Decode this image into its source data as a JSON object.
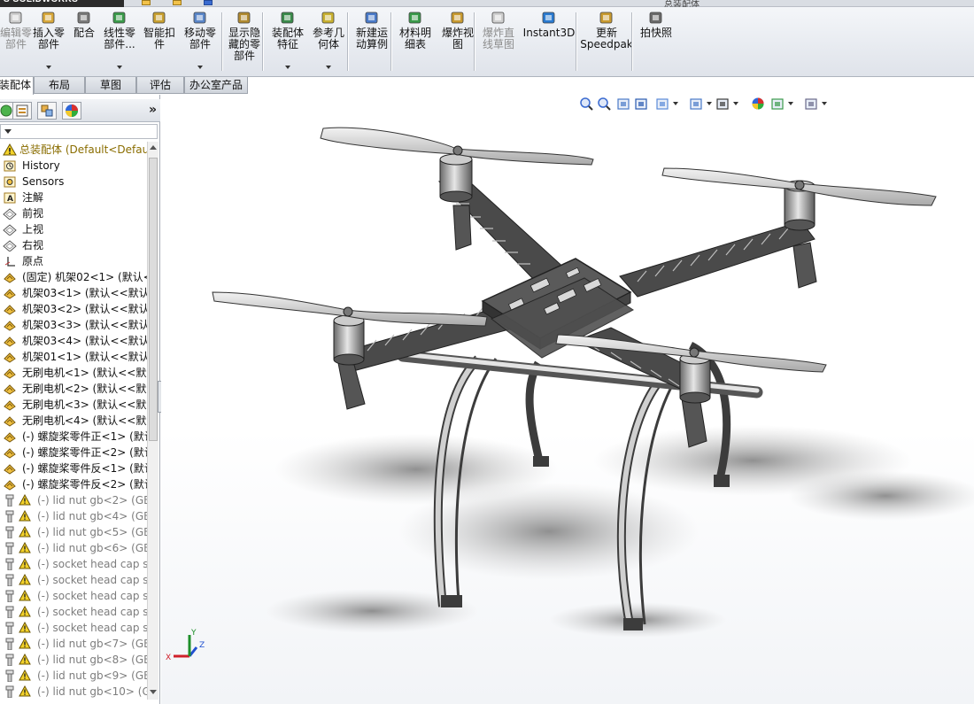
{
  "app": {
    "logo": "S SOLIDWORKS",
    "title_fragment": "总装配体"
  },
  "ribbon": {
    "buttons": [
      {
        "label": "编辑零\n部件",
        "disabled": true,
        "dropdown": false,
        "icon": "edit-component-icon"
      },
      {
        "label": "插入零\n部件",
        "disabled": false,
        "dropdown": true,
        "icon": "insert-component-icon"
      },
      {
        "label": "配合",
        "disabled": false,
        "dropdown": false,
        "icon": "mate-icon"
      },
      {
        "label": "线性零\n部件...",
        "disabled": false,
        "dropdown": true,
        "icon": "linear-pattern-icon"
      },
      {
        "label": "智能扣\n件",
        "disabled": false,
        "dropdown": false,
        "icon": "smart-fasteners-icon"
      },
      {
        "label": "移动零\n部件",
        "disabled": false,
        "dropdown": true,
        "icon": "move-component-icon"
      },
      {
        "label": "显示隐\n藏的零\n部件",
        "disabled": false,
        "dropdown": false,
        "icon": "show-hidden-icon"
      },
      {
        "label": "装配体\n特征",
        "disabled": false,
        "dropdown": true,
        "icon": "assembly-features-icon"
      },
      {
        "label": "参考几\n何体",
        "disabled": false,
        "dropdown": true,
        "icon": "reference-geometry-icon"
      },
      {
        "label": "新建运\n动算例",
        "disabled": false,
        "dropdown": false,
        "icon": "motion-study-icon"
      },
      {
        "label": "材料明\n细表",
        "disabled": false,
        "dropdown": false,
        "icon": "bom-icon"
      },
      {
        "label": "爆炸视\n图",
        "disabled": false,
        "dropdown": false,
        "icon": "exploded-view-icon"
      },
      {
        "label": "爆炸直\n线草图",
        "disabled": true,
        "dropdown": false,
        "icon": "explode-line-sketch-icon"
      },
      {
        "label": "Instant3D",
        "disabled": false,
        "dropdown": false,
        "icon": "instant3d-icon"
      },
      {
        "label": "更新\nSpeedpak",
        "disabled": false,
        "dropdown": false,
        "icon": "speedpak-icon"
      },
      {
        "label": "拍快照",
        "disabled": false,
        "dropdown": false,
        "icon": "snapshot-icon"
      }
    ]
  },
  "tabs": [
    "装配体",
    "布局",
    "草图",
    "评估",
    "办公室产品"
  ],
  "active_tab": "装配体",
  "panel": {
    "expand_label": "»",
    "tabs": [
      "featuremanager-icon",
      "propertymanager-icon",
      "configurationmanager-icon",
      "appearance-icon"
    ]
  },
  "tree": [
    {
      "label": "总装配体  (Default<Defau",
      "kind": "root",
      "icon": "assembly-icon",
      "warn": true
    },
    {
      "label": "History",
      "kind": "item",
      "icon": "history-icon",
      "warn": false
    },
    {
      "label": "Sensors",
      "kind": "item",
      "icon": "sensors-icon",
      "warn": false
    },
    {
      "label": "注解",
      "kind": "item",
      "icon": "annotations-icon",
      "warn": false
    },
    {
      "label": "前视",
      "kind": "item",
      "icon": "plane-icon",
      "warn": false
    },
    {
      "label": "上视",
      "kind": "item",
      "icon": "plane-icon",
      "warn": false
    },
    {
      "label": "右视",
      "kind": "item",
      "icon": "plane-icon",
      "warn": false
    },
    {
      "label": "原点",
      "kind": "item",
      "icon": "origin-icon",
      "warn": false
    },
    {
      "label": "(固定) 机架02<1> (默认<",
      "kind": "item",
      "icon": "part-icon",
      "warn": false
    },
    {
      "label": "机架03<1> (默认<<默认",
      "kind": "item",
      "icon": "part-icon",
      "warn": false
    },
    {
      "label": "机架03<2> (默认<<默认",
      "kind": "item",
      "icon": "part-icon",
      "warn": false
    },
    {
      "label": "机架03<3> (默认<<默认",
      "kind": "item",
      "icon": "part-icon",
      "warn": false
    },
    {
      "label": "机架03<4> (默认<<默认",
      "kind": "item",
      "icon": "part-icon",
      "warn": false
    },
    {
      "label": "机架01<1> (默认<<默认",
      "kind": "item",
      "icon": "part-icon",
      "warn": false
    },
    {
      "label": "无刷电机<1> (默认<<默认",
      "kind": "item",
      "icon": "part-icon",
      "warn": false
    },
    {
      "label": "无刷电机<2> (默认<<默认",
      "kind": "item",
      "icon": "part-icon",
      "warn": false
    },
    {
      "label": "无刷电机<3> (默认<<默认",
      "kind": "item",
      "icon": "part-icon",
      "warn": false
    },
    {
      "label": "无刷电机<4> (默认<<默认",
      "kind": "item",
      "icon": "part-icon",
      "warn": false
    },
    {
      "label": "(-) 螺旋桨零件正<1> (默认",
      "kind": "item",
      "icon": "part-icon",
      "warn": false
    },
    {
      "label": "(-) 螺旋桨零件正<2> (默认",
      "kind": "item",
      "icon": "part-icon",
      "warn": false
    },
    {
      "label": "(-) 螺旋桨零件反<1> (默认",
      "kind": "item",
      "icon": "part-icon",
      "warn": false
    },
    {
      "label": "(-) 螺旋桨零件反<2> (默认",
      "kind": "item",
      "icon": "part-icon",
      "warn": false
    },
    {
      "label": "(-) lid nut gb<2> (GB",
      "kind": "dim",
      "icon": "toolbox-part-icon",
      "warn": true
    },
    {
      "label": "(-) lid nut gb<4> (GB",
      "kind": "dim",
      "icon": "toolbox-part-icon",
      "warn": true
    },
    {
      "label": "(-) lid nut gb<5> (GB",
      "kind": "dim",
      "icon": "toolbox-part-icon",
      "warn": true
    },
    {
      "label": "(-) lid nut gb<6> (GB",
      "kind": "dim",
      "icon": "toolbox-part-icon",
      "warn": true
    },
    {
      "label": "(-) socket head cap s",
      "kind": "dim",
      "icon": "toolbox-part-icon",
      "warn": true
    },
    {
      "label": "(-) socket head cap s",
      "kind": "dim",
      "icon": "toolbox-part-icon",
      "warn": true
    },
    {
      "label": "(-) socket head cap s",
      "kind": "dim",
      "icon": "toolbox-part-icon",
      "warn": true
    },
    {
      "label": "(-) socket head cap s",
      "kind": "dim",
      "icon": "toolbox-part-icon",
      "warn": true
    },
    {
      "label": "(-) socket head cap s",
      "kind": "dim",
      "icon": "toolbox-part-icon",
      "warn": true
    },
    {
      "label": "(-) lid nut gb<7> (GB",
      "kind": "dim",
      "icon": "toolbox-part-icon",
      "warn": true
    },
    {
      "label": "(-) lid nut gb<8> (GB",
      "kind": "dim",
      "icon": "toolbox-part-icon",
      "warn": true
    },
    {
      "label": "(-) lid nut gb<9> (GB",
      "kind": "dim",
      "icon": "toolbox-part-icon",
      "warn": true
    },
    {
      "label": "(-) lid nut gb<10> (G",
      "kind": "dim",
      "icon": "toolbox-part-icon",
      "warn": true
    }
  ],
  "heads_up_toolbar": [
    "zoom-to-fit-icon",
    "zoom-to-area-icon",
    "previous-view-icon",
    "section-view-icon",
    "view-orientation-icon",
    "display-style-icon",
    "hide-show-items-icon",
    "edit-appearance-icon",
    "apply-scene-icon",
    "view-settings-icon"
  ],
  "triad": {
    "x_label": "X",
    "y_label": "Y",
    "z_label": "Z"
  },
  "colors": {
    "accent": "#f3c24a",
    "warning": "#e8c21a",
    "axis_x": "#d0202a",
    "axis_y": "#1e8f2a",
    "axis_z": "#1f4fd0"
  }
}
